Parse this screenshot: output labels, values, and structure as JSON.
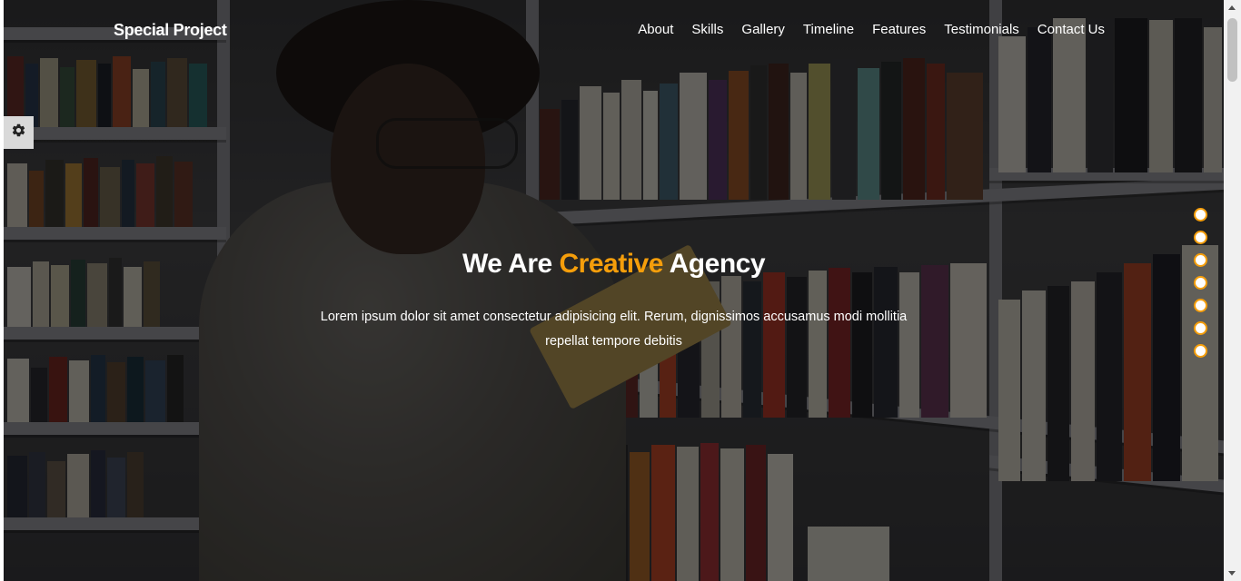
{
  "header": {
    "logo": "Special Project",
    "nav": [
      "About",
      "Skills",
      "Gallery",
      "Timeline",
      "Features",
      "Testimonials",
      "Contact Us"
    ]
  },
  "settings": {
    "icon": "gear-icon"
  },
  "hero": {
    "title_pre": "We Are ",
    "title_accent": "Creative",
    "title_post": " Agency",
    "text": "Lorem ipsum dolor sit amet consectetur adipisicing elit. Rerum, dignissimos accusamus modi mollitia repellat tempore debitis"
  },
  "bullets_count": 7,
  "colors": {
    "accent": "#f59e0b",
    "text": "#ffffff",
    "overlay": "rgba(0,0,0,0.55)"
  }
}
